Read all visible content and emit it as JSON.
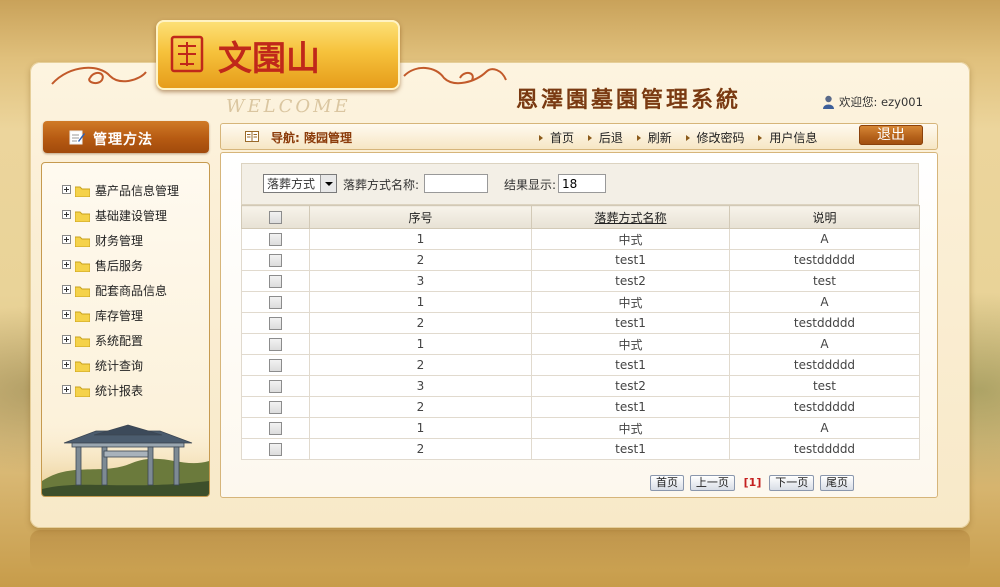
{
  "header": {
    "logo_text": "文園山",
    "welcome_watermark": "WELCOME",
    "system_title": "恩澤園墓園管理系統",
    "welcome_user": "欢迎您: ezy001"
  },
  "sidebar": {
    "title": "管理方法",
    "items": [
      {
        "label": "墓产品信息管理"
      },
      {
        "label": "基础建设管理"
      },
      {
        "label": "财务管理"
      },
      {
        "label": "售后服务"
      },
      {
        "label": "配套商品信息"
      },
      {
        "label": "库存管理"
      },
      {
        "label": "系统配置"
      },
      {
        "label": "统计查询"
      },
      {
        "label": "统计报表"
      }
    ]
  },
  "nav": {
    "breadcrumb": "导航: 陵园管理",
    "links": [
      {
        "label": "首页"
      },
      {
        "label": "后退"
      },
      {
        "label": "刷新"
      },
      {
        "label": "修改密码"
      },
      {
        "label": "用户信息"
      }
    ],
    "logout": "退出"
  },
  "filter": {
    "select_value": "落葬方式",
    "name_label": "落葬方式名称:",
    "name_value": "",
    "result_label": "结果显示:",
    "result_value": "18"
  },
  "table": {
    "columns": [
      "",
      "序号",
      "落葬方式名称",
      "说明"
    ],
    "rows": [
      {
        "no": "1",
        "name": "中式",
        "desc": "A"
      },
      {
        "no": "2",
        "name": "test1",
        "desc": "testddddd"
      },
      {
        "no": "3",
        "name": "test2",
        "desc": "test"
      },
      {
        "no": "1",
        "name": "中式",
        "desc": "A"
      },
      {
        "no": "2",
        "name": "test1",
        "desc": "testddddd"
      },
      {
        "no": "1",
        "name": "中式",
        "desc": "A"
      },
      {
        "no": "2",
        "name": "test1",
        "desc": "testddddd"
      },
      {
        "no": "3",
        "name": "test2",
        "desc": "test"
      },
      {
        "no": "2",
        "name": "test1",
        "desc": "testddddd"
      },
      {
        "no": "1",
        "name": "中式",
        "desc": "A"
      },
      {
        "no": "2",
        "name": "test1",
        "desc": "testddddd"
      }
    ]
  },
  "pager": {
    "first": "首页",
    "prev": "上一页",
    "current": "[1]",
    "next": "下一页",
    "last": "尾页"
  },
  "colors": {
    "accent": "#b65a12",
    "title": "#7a3a12",
    "background": "#e9d398"
  }
}
